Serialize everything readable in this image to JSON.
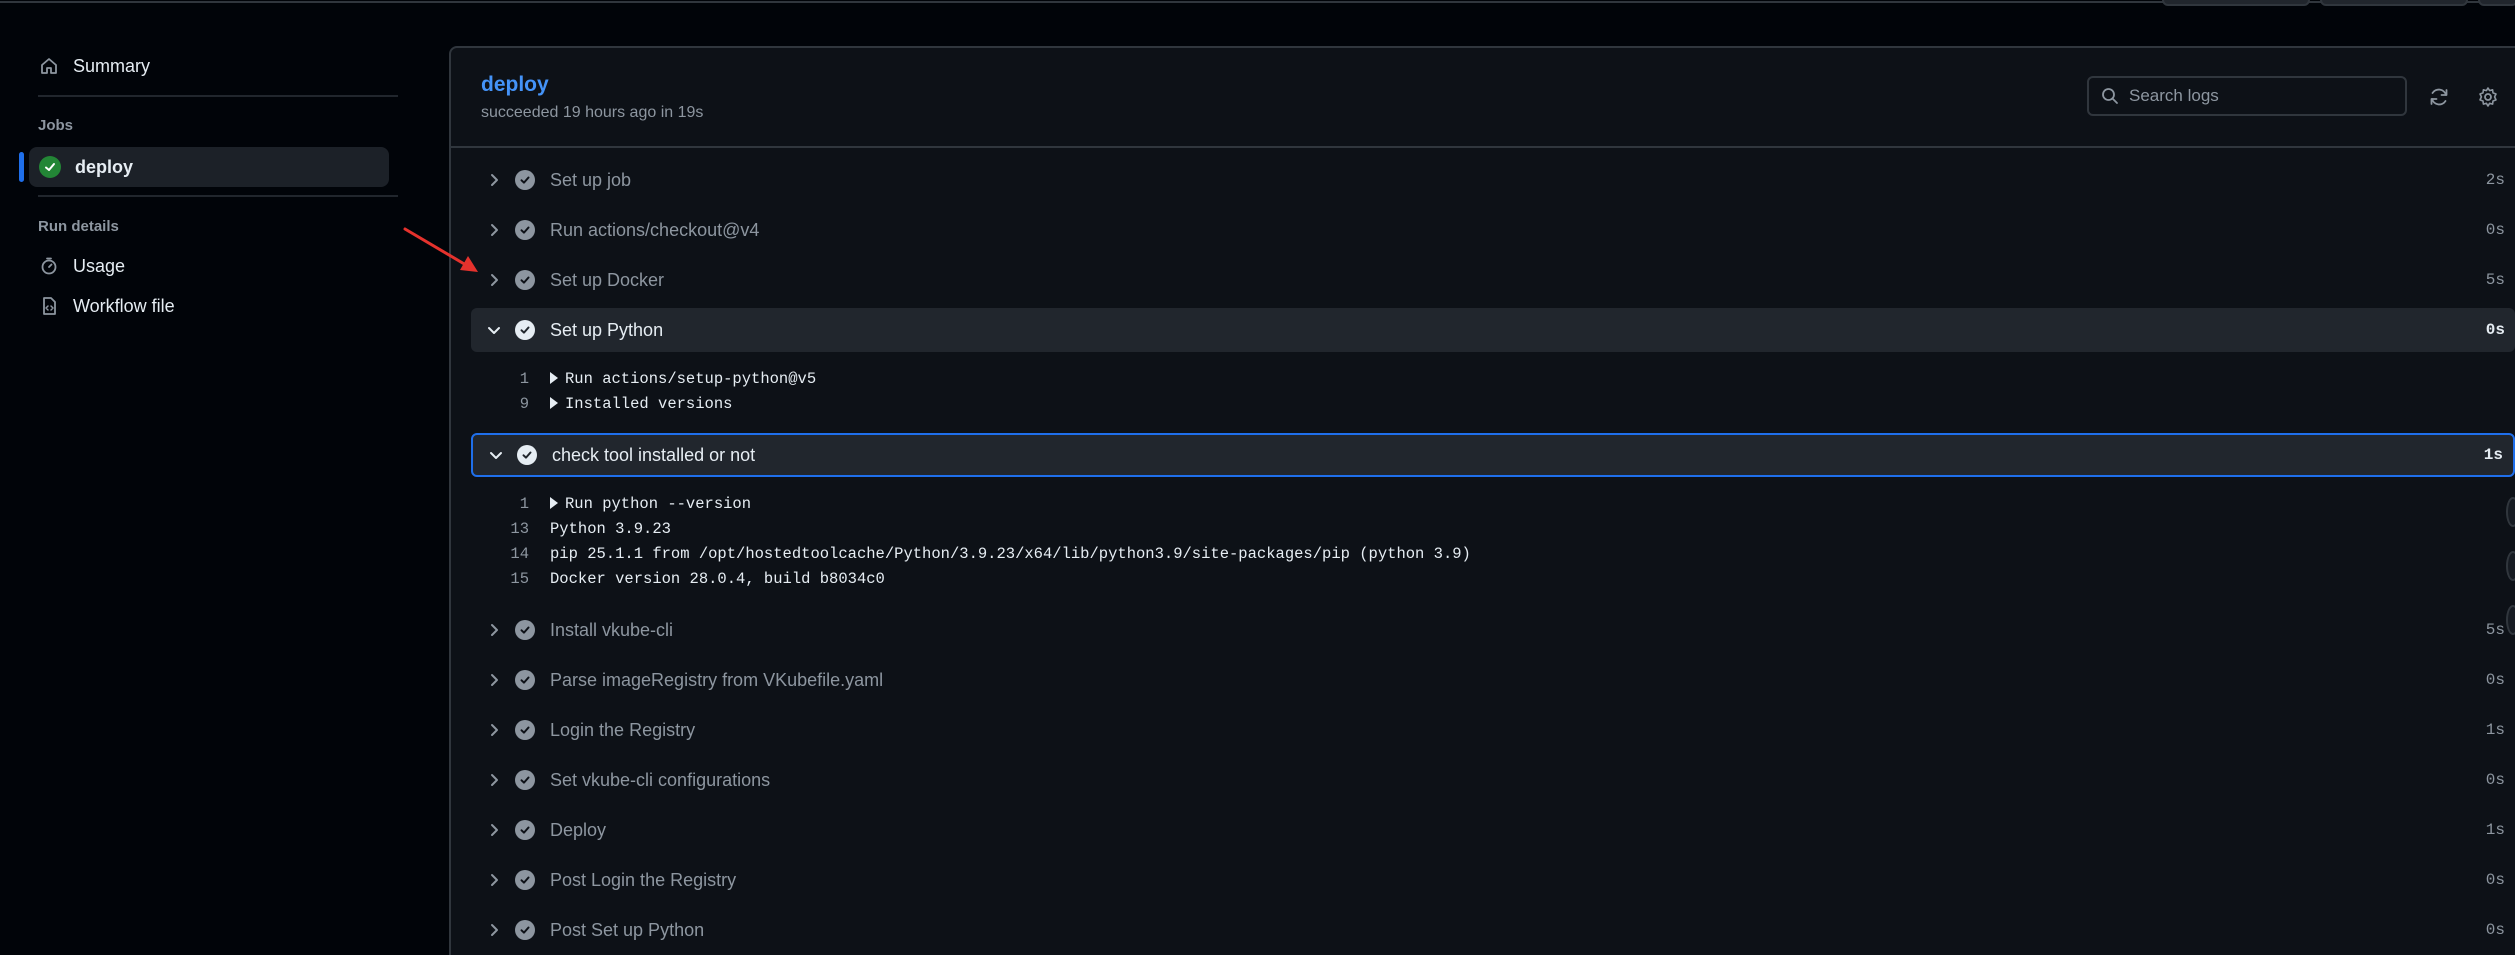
{
  "sidebar": {
    "summary_label": "Summary",
    "jobs_heading": "Jobs",
    "job_label": "deploy",
    "run_details_heading": "Run details",
    "usage_label": "Usage",
    "workflow_file_label": "Workflow file"
  },
  "header": {
    "job_title": "deploy",
    "status_text": "succeeded 19 hours ago in 19s",
    "search_placeholder": "Search logs",
    "refresh_icon": "sync-icon",
    "settings_icon": "gear-icon"
  },
  "steps": [
    {
      "name": "Set up job",
      "duration": "2s",
      "expanded": false
    },
    {
      "name": "Run actions/checkout@v4",
      "duration": "0s",
      "expanded": false
    },
    {
      "name": "Set up Docker",
      "duration": "5s",
      "expanded": false
    },
    {
      "name": "Set up Python",
      "duration": "0s",
      "expanded": true,
      "log": [
        {
          "line": "1",
          "text": "Run actions/setup-python@v5",
          "collapsible": true
        },
        {
          "line": "9",
          "text": "Installed versions",
          "collapsible": true
        }
      ]
    },
    {
      "name": "check tool installed or not",
      "duration": "1s",
      "expanded": true,
      "log": [
        {
          "line": "1",
          "text": "Run python --version",
          "collapsible": true
        },
        {
          "line": "13",
          "text": "Python 3.9.23",
          "collapsible": false
        },
        {
          "line": "14",
          "text": "pip 25.1.1 from /opt/hostedtoolcache/Python/3.9.23/x64/lib/python3.9/site-packages/pip (python 3.9)",
          "collapsible": false
        },
        {
          "line": "15",
          "text": "Docker version 28.0.4, build b8034c0",
          "collapsible": false
        }
      ]
    },
    {
      "name": "Install vkube-cli",
      "duration": "5s",
      "expanded": false
    },
    {
      "name": "Parse imageRegistry from VKubefile.yaml",
      "duration": "0s",
      "expanded": false
    },
    {
      "name": "Login the Registry",
      "duration": "1s",
      "expanded": false
    },
    {
      "name": "Set vkube-cli configurations",
      "duration": "0s",
      "expanded": false
    },
    {
      "name": "Deploy",
      "duration": "1s",
      "expanded": false
    },
    {
      "name": "Post Login the Registry",
      "duration": "0s",
      "expanded": false
    },
    {
      "name": "Post Set up Python",
      "duration": "0s",
      "expanded": false
    }
  ],
  "colors": {
    "accent": "#4493f8",
    "success": "#238636",
    "focus_border": "#1f6feb",
    "annotation_arrow": "#e5322d"
  }
}
